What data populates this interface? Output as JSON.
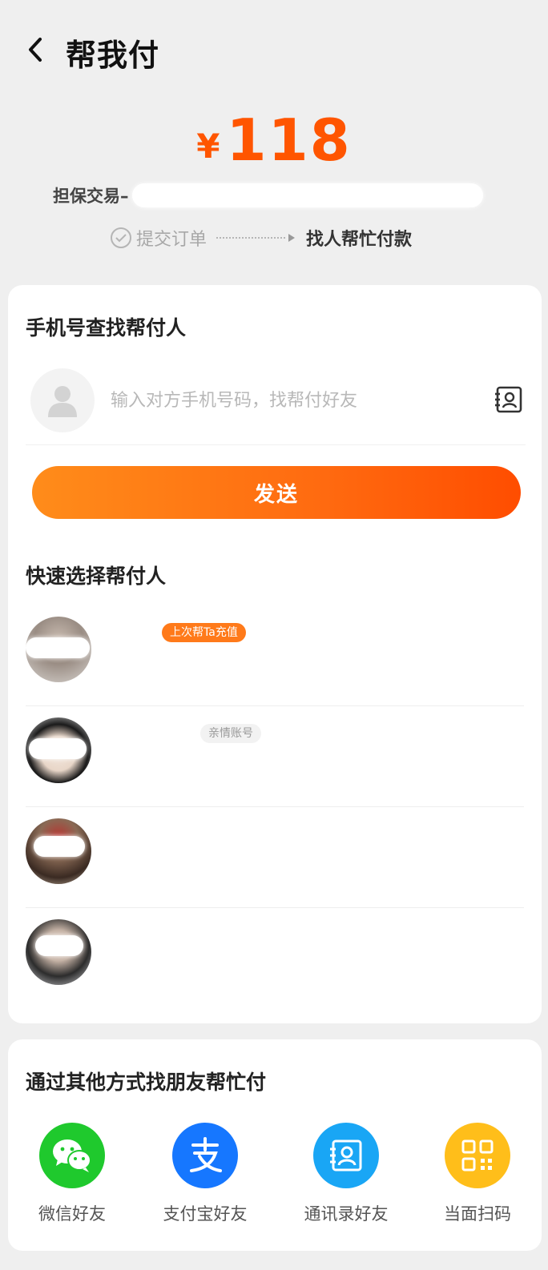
{
  "header": {
    "title": "帮我付"
  },
  "order": {
    "currency": "¥",
    "amount": "118",
    "description": "担保交易–",
    "steps": {
      "step1": "提交订单",
      "step2": "找人帮忙付款"
    }
  },
  "phone_search": {
    "title": "手机号查找帮付人",
    "placeholder": "输入对方手机号码，找帮付好友",
    "send_label": "发送"
  },
  "quick_select": {
    "title": "快速选择帮付人",
    "friends": [
      {
        "tag": "上次帮Ta充值"
      },
      {
        "tag": "亲情账号"
      },
      {
        "tag": ""
      },
      {
        "tag": ""
      }
    ]
  },
  "other_methods": {
    "title": "通过其他方式找朋友帮忙付",
    "items": [
      {
        "label": "微信好友",
        "icon": "wechat-icon",
        "color": "#1fc92d"
      },
      {
        "label": "支付宝好友",
        "icon": "alipay-icon",
        "color": "#1677ff"
      },
      {
        "label": "通讯录好友",
        "icon": "contacts-icon",
        "color": "#19a6f5"
      },
      {
        "label": "当面扫码",
        "icon": "qr-code-icon",
        "color": "#ffbe1a"
      }
    ]
  },
  "colors": {
    "accent": "#ff5500"
  }
}
